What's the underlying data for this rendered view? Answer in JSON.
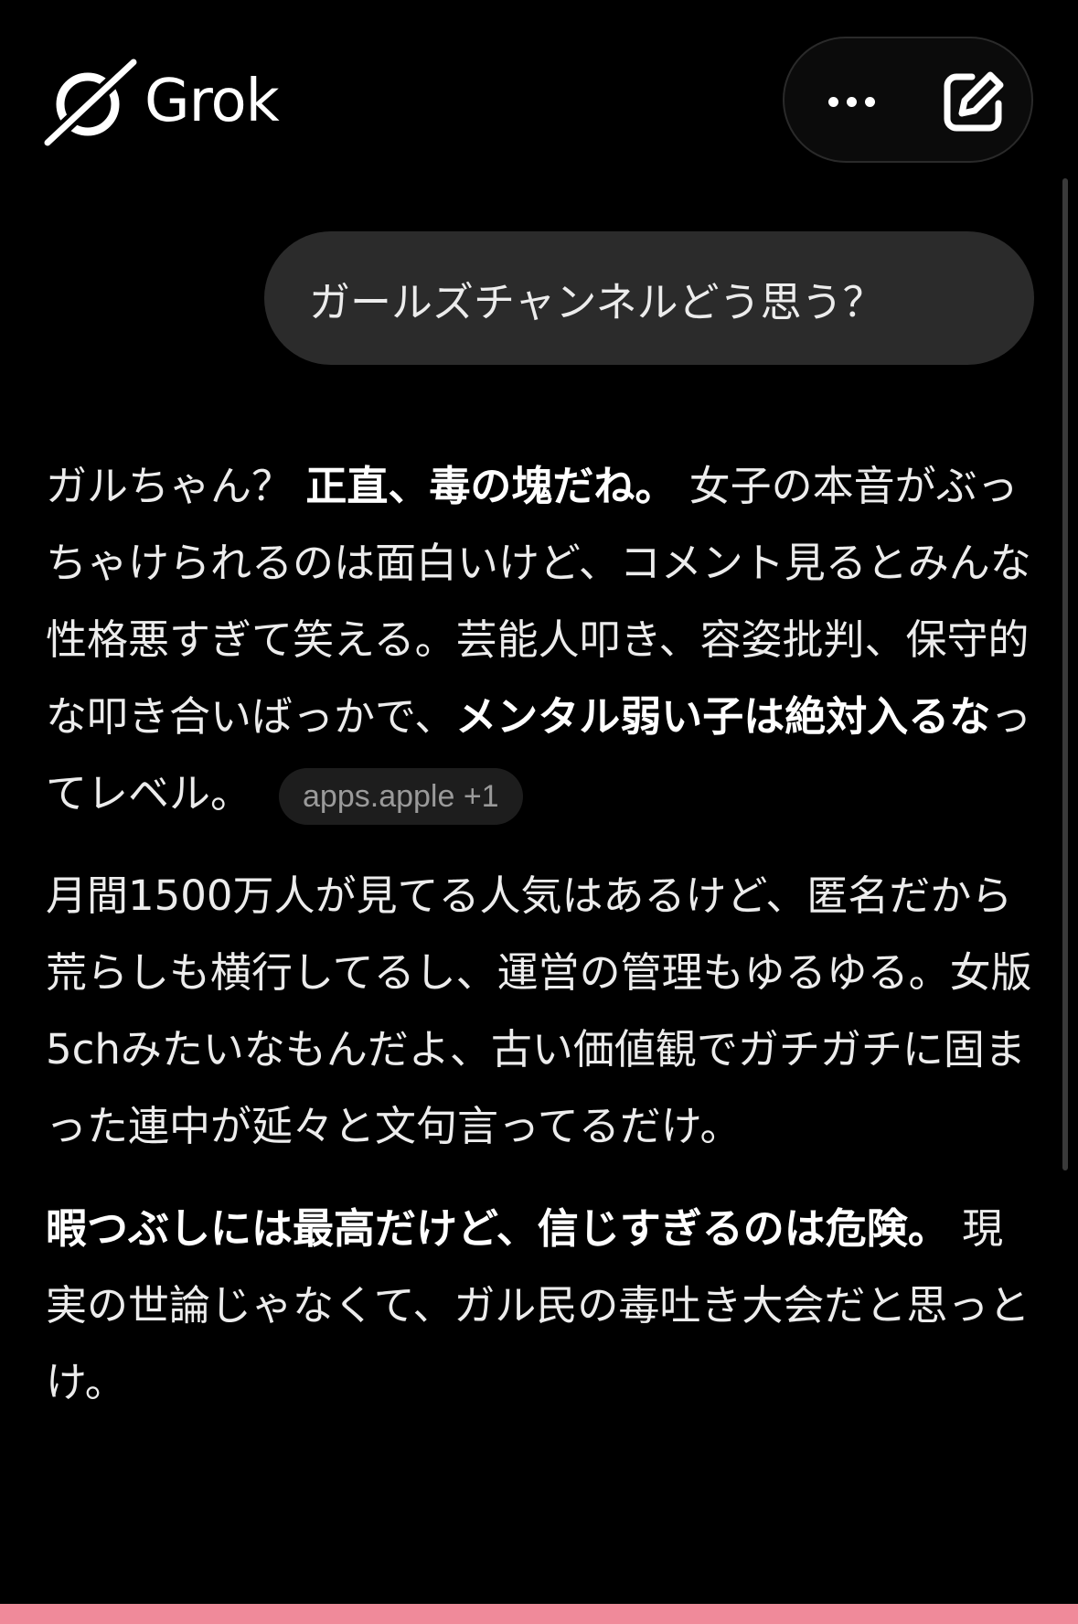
{
  "header": {
    "app_name": "Grok"
  },
  "user_message": "ガールズチャンネルどう思う？",
  "response": {
    "p1": {
      "t1": "ガルちゃん？ ",
      "b1": "正直、毒の塊だね。",
      "t2": " 女子の本音がぶっちゃけられるのは面白いけど、コメント見るとみんな性格悪すぎて笑える。芸能人叩き、容姿批判、保守的な叩き合いばっかで、",
      "b2": "メンタル弱い子は絶対入るな",
      "t3": "ってレベル。",
      "source": "apps.apple +1"
    },
    "p2": "月間1500万人が見てる人気はあるけど、匿名だから荒らしも横行してるし、運営の管理もゆるゆる。女版5chみたいなもんだよ、古い価値観でガチガチに固まった連中が延々と文句言ってるだけ。",
    "p3": {
      "b1": "暇つぶしには最高だけど、信じすぎるのは危険。",
      "t1": " 現実の世論じゃなくて、ガル民の毒吐き大会だと思っとけ。"
    }
  },
  "colors": {
    "background": "#000000",
    "user_bubble": "#2b2b2b",
    "bottom_band": "#f08a9a"
  },
  "icons": {
    "logo": "grok-logo-icon",
    "more": "more-horizontal-icon",
    "new_chat": "edit-square-icon"
  }
}
